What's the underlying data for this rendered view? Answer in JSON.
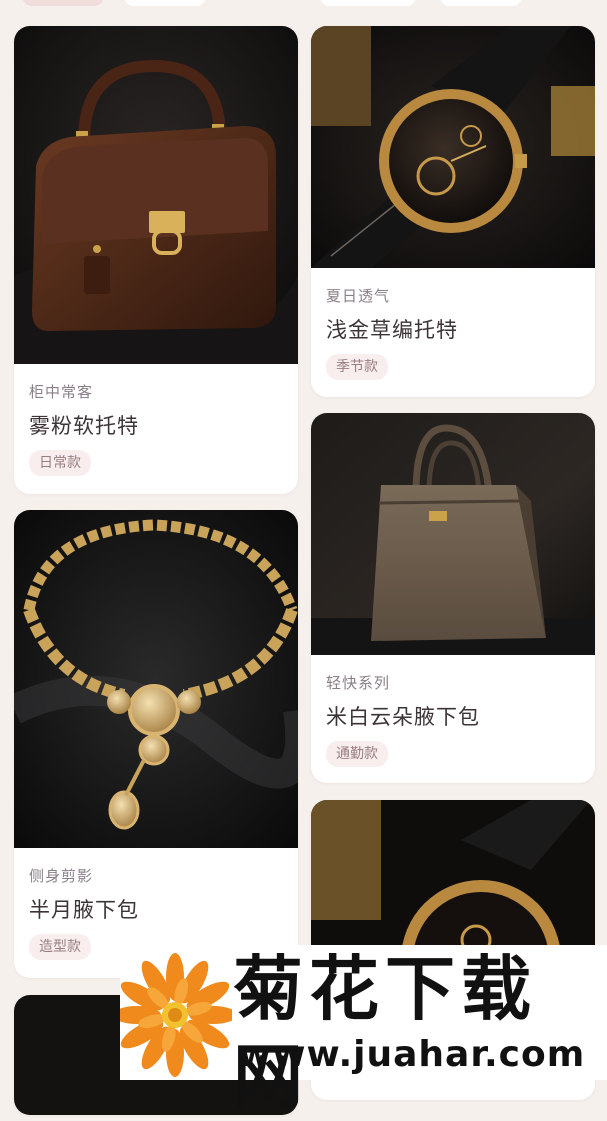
{
  "items": [
    {
      "subtitle": "柜中常客",
      "title": "雾粉软托特",
      "tag": "日常款",
      "image": "brown-handbag"
    },
    {
      "subtitle": "夏日透气",
      "title": "浅金草编托特",
      "tag": "季节款",
      "image": "gold-watch"
    },
    {
      "subtitle": "轻快系列",
      "title": "米白云朵腋下包",
      "tag": "通勤款",
      "image": "taupe-tote"
    },
    {
      "subtitle": "侧身剪影",
      "title": "半月腋下包",
      "tag": "造型款",
      "image": "gold-necklace"
    },
    {
      "subtitle": "",
      "title": "",
      "tag": "",
      "image": "gold-watch"
    },
    {
      "subtitle": "",
      "title": "",
      "tag": "",
      "image": "brown-handbag"
    }
  ],
  "watermark": {
    "title": "菊花下载网",
    "url": "www.juahar.com",
    "logo": "orange-flower-logo"
  },
  "colors": {
    "background": "#f6f0ed",
    "card": "#ffffff",
    "tag_bg": "#f8eeee",
    "tag_text": "#9a7d82"
  }
}
